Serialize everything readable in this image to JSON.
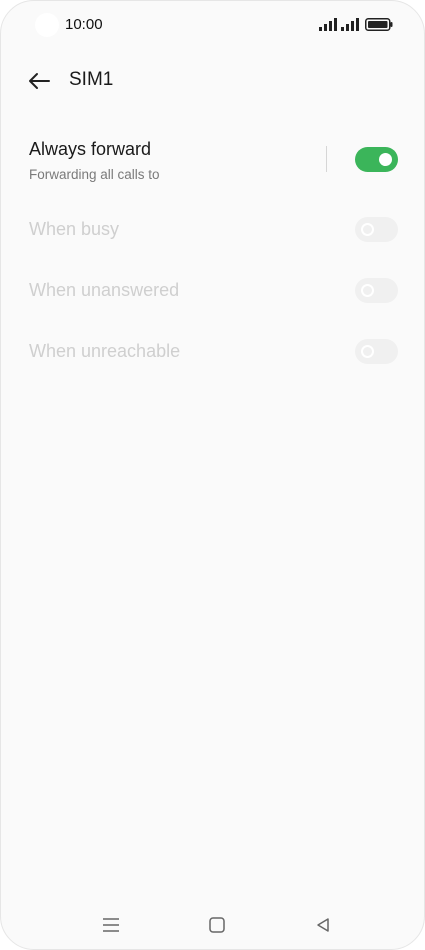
{
  "status_bar": {
    "time": "10:00",
    "icons": [
      "camera-cutout",
      "signal-icon",
      "signal-icon",
      "battery-icon"
    ]
  },
  "header": {
    "back_icon": "arrow-left-icon",
    "title": "SIM1"
  },
  "settings": [
    {
      "title": "Always forward",
      "subtitle": "Forwarding all calls to",
      "enabled": true,
      "state": "on"
    },
    {
      "title": "When busy",
      "enabled": false,
      "state": "off"
    },
    {
      "title": "When unanswered",
      "enabled": false,
      "state": "off"
    },
    {
      "title": "When unreachable",
      "enabled": false,
      "state": "off"
    }
  ],
  "colors": {
    "accent": "#3bb55a",
    "background": "#fafafa",
    "disabled_text": "#cfcfcf"
  },
  "nav_bar": {
    "icons": [
      "menu-icon",
      "home-square-icon",
      "back-triangle-icon"
    ]
  }
}
